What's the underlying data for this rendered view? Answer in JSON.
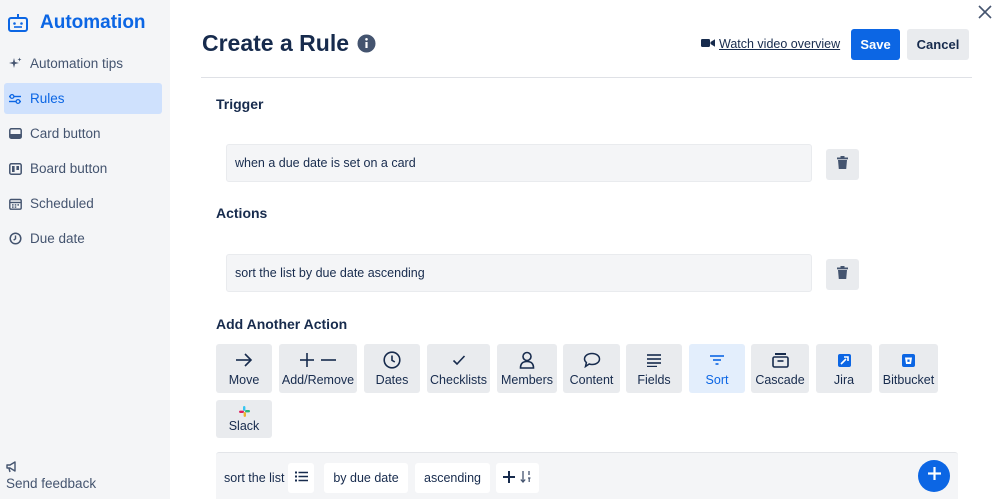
{
  "sidebar": {
    "title": "Automation",
    "items": [
      {
        "label": "Automation tips",
        "icon": "sparkle-icon"
      },
      {
        "label": "Rules",
        "icon": "sliders-icon"
      },
      {
        "label": "Card button",
        "icon": "card-icon"
      },
      {
        "label": "Board button",
        "icon": "board-icon"
      },
      {
        "label": "Scheduled",
        "icon": "calendar-icon"
      },
      {
        "label": "Due date",
        "icon": "clock-icon"
      }
    ],
    "active_item": "Rules",
    "feedback": "Send feedback"
  },
  "header": {
    "title": "Create a Rule",
    "video_link": "Watch video overview",
    "save": "Save",
    "cancel": "Cancel"
  },
  "trigger": {
    "label": "Trigger",
    "text": "when a due date is set on a card"
  },
  "actions": {
    "label": "Actions",
    "text": "sort the list by due date ascending"
  },
  "add_action": {
    "label": "Add Another Action",
    "tiles": [
      {
        "label": "Move",
        "icon": "arrow-right-icon"
      },
      {
        "label": "Add/Remove",
        "icon": "plus-minus-icon"
      },
      {
        "label": "Dates",
        "icon": "clock-icon"
      },
      {
        "label": "Checklists",
        "icon": "check-icon"
      },
      {
        "label": "Members",
        "icon": "person-icon"
      },
      {
        "label": "Content",
        "icon": "speech-bubble-icon"
      },
      {
        "label": "Fields",
        "icon": "lines-icon"
      },
      {
        "label": "Sort",
        "icon": "filter-icon"
      },
      {
        "label": "Cascade",
        "icon": "archive-icon"
      },
      {
        "label": "Jira",
        "icon": "jira-icon"
      },
      {
        "label": "Bitbucket",
        "icon": "bitbucket-icon"
      },
      {
        "label": "Slack",
        "icon": "slack-icon"
      }
    ],
    "active_tile": "Sort"
  },
  "builder": {
    "prefix": "sort the list",
    "field": "by due date",
    "order": "ascending"
  },
  "colors": {
    "accent": "#0c66e4",
    "sidebar_bg": "#f4f5f7",
    "active_bg": "#cfe1fd",
    "button_gray": "#e9ebee",
    "text": "#172b4d"
  }
}
